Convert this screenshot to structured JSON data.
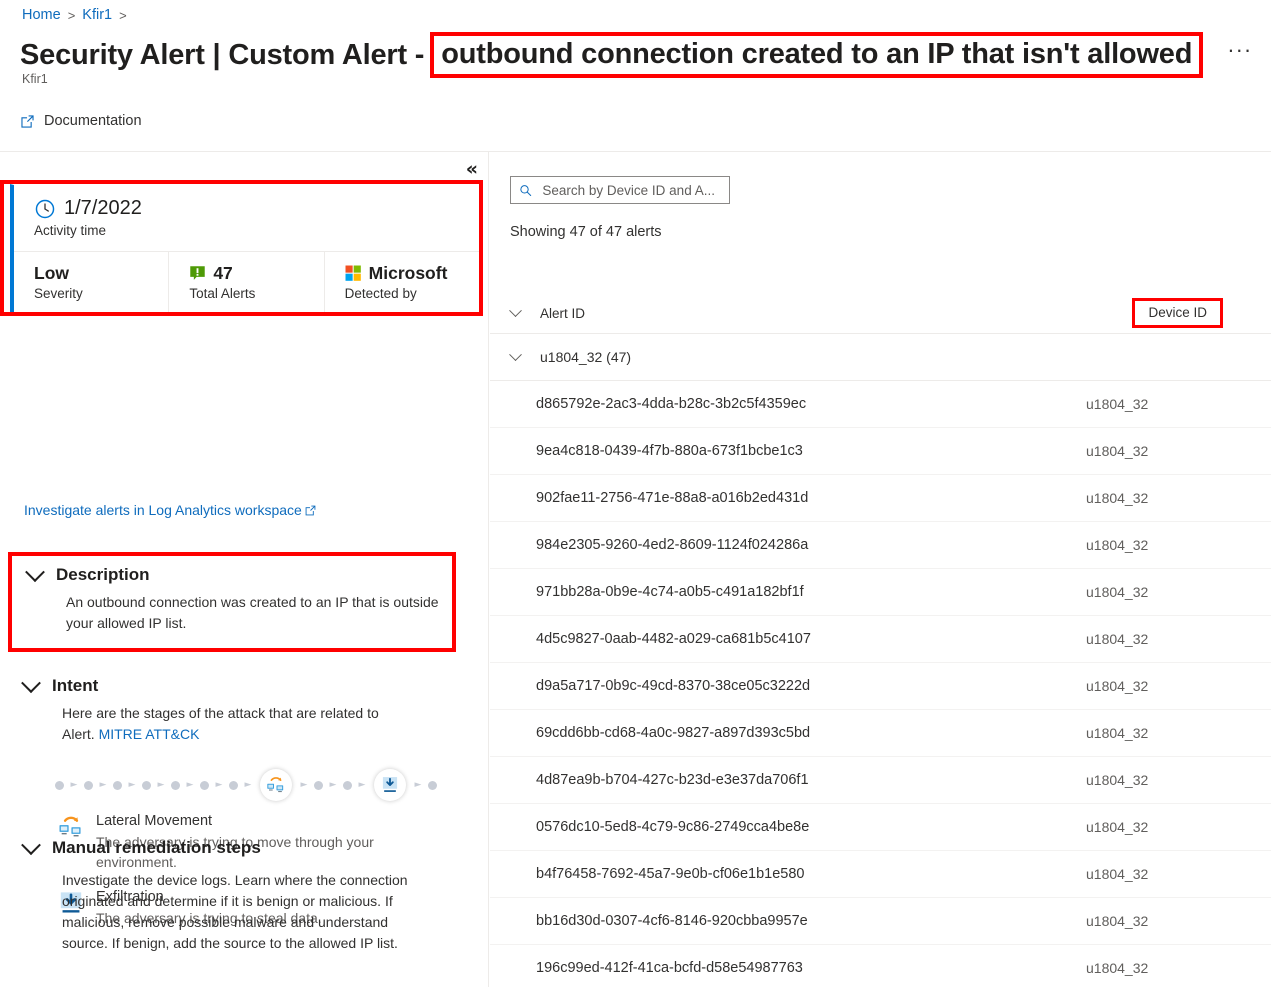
{
  "breadcrumb": {
    "items": [
      "Home",
      "Kfir1"
    ],
    "separator": ">"
  },
  "header": {
    "title_prefix": "Security Alert | Custom Alert -",
    "title_highlight": "outbound connection created to an IP that isn't allowed",
    "more_label": "···",
    "subtitle": "Kfir1"
  },
  "commandbar": {
    "documentation_label": "Documentation"
  },
  "left": {
    "collapse_label": "«",
    "summary_card": {
      "activity_time_value": "1/7/2022",
      "activity_time_label": "Activity time",
      "severity_value": "Low",
      "severity_label": "Severity",
      "total_alerts_value": "47",
      "total_alerts_label": "Total Alerts",
      "detected_by_value": "Microsoft",
      "detected_by_label": "Detected by",
      "accent_color": "#0078d4",
      "highlight_color": "#ff0000"
    },
    "investigate_link": "Investigate alerts in Log Analytics workspace",
    "description": {
      "heading": "Description",
      "body": "An outbound connection was created to an IP that is outside your allowed IP list."
    },
    "intent": {
      "heading": "Intent",
      "body_text": "Here are the stages of the attack that are related to Alert.",
      "link_text": "MITRE ATT&CK",
      "timeline": {
        "dots_before": 7,
        "dots_between": 2,
        "dots_after": 1,
        "stages": [
          "lateral-movement",
          "exfiltration"
        ]
      },
      "items": [
        {
          "icon": "lateral-movement-icon",
          "name": "Lateral Movement",
          "desc": "The adversary is trying to move through your environment."
        },
        {
          "icon": "exfiltration-icon",
          "name": "Exfiltration",
          "desc": "The adversary is trying to steal data."
        }
      ]
    },
    "remediation": {
      "heading": "Manual remediation steps",
      "body": "Investigate the device logs. Learn where the connection originated and determine if it is benign or malicious. If malicious, remove possible malware and understand source. If benign, add the source to the allowed IP list."
    }
  },
  "right": {
    "search": {
      "placeholder": "Search by Device ID and A...",
      "value": "",
      "icon": "search-icon"
    },
    "showing_text": "Showing 47 of 47 alerts",
    "table": {
      "columns": [
        "Alert ID",
        "Device ID"
      ],
      "group": {
        "label": "u1804_32 (47)"
      },
      "rows": [
        {
          "alert_id": "d865792e-2ac3-4dda-b28c-3b2c5f4359ec",
          "device_id": "u1804_32"
        },
        {
          "alert_id": "9ea4c818-0439-4f7b-880a-673f1bcbe1c3",
          "device_id": "u1804_32"
        },
        {
          "alert_id": "902fae11-2756-471e-88a8-a016b2ed431d",
          "device_id": "u1804_32"
        },
        {
          "alert_id": "984e2305-9260-4ed2-8609-1124f024286a",
          "device_id": "u1804_32"
        },
        {
          "alert_id": "971bb28a-0b9e-4c74-a0b5-c491a182bf1f",
          "device_id": "u1804_32"
        },
        {
          "alert_id": "4d5c9827-0aab-4482-a029-ca681b5c4107",
          "device_id": "u1804_32"
        },
        {
          "alert_id": "d9a5a717-0b9c-49cd-8370-38ce05c3222d",
          "device_id": "u1804_32"
        },
        {
          "alert_id": "69cdd6bb-cd68-4a0c-9827-a897d393c5bd",
          "device_id": "u1804_32"
        },
        {
          "alert_id": "4d87ea9b-b704-427c-b23d-e3e37da706f1",
          "device_id": "u1804_32"
        },
        {
          "alert_id": "0576dc10-5ed8-4c79-9c86-2749cca4be8e",
          "device_id": "u1804_32"
        },
        {
          "alert_id": "b4f76458-7692-45a7-9e0b-cf06e1b1e580",
          "device_id": "u1804_32"
        },
        {
          "alert_id": "bb16d30d-0307-4cf6-8146-920cbba9957e",
          "device_id": "u1804_32"
        },
        {
          "alert_id": "196c99ed-412f-41ca-bcfd-d58e54987763",
          "device_id": "u1804_32"
        }
      ]
    }
  }
}
